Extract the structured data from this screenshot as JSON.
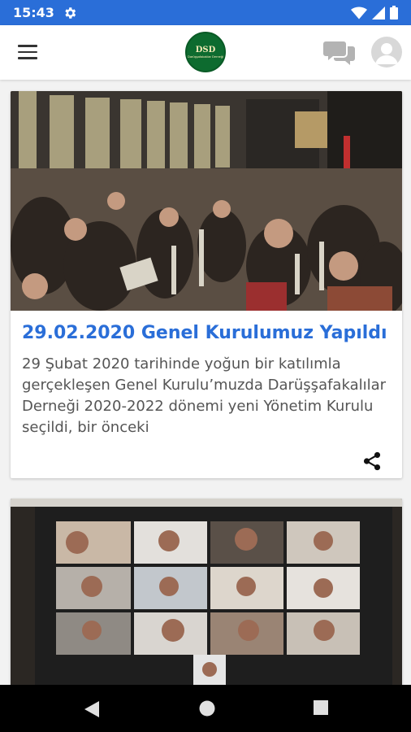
{
  "status_bar": {
    "time": "15:43",
    "icons": [
      "settings-gear-icon",
      "wifi-icon",
      "cellular-signal-icon",
      "battery-icon"
    ],
    "background": "#2a6ed8"
  },
  "app_bar": {
    "logo_monogram": "DSD",
    "logo_text": "Darüşşafakalılar Derneği",
    "icons": [
      "menu-icon",
      "chat-icon",
      "account-icon"
    ]
  },
  "feed": {
    "posts": [
      {
        "title": "29.02.2020 Genel Kurulumuz Yapıldı",
        "excerpt": "29 Şubat 2020 tarihinde yoğun bir katılımla gerçekleşen Genel Kurulu’muzda Darüşşafakalılar Derneği 2020-2022 dönemi yeni Yönetim Kurulu seçildi, bir önceki",
        "image": "conference-hall-audience-photo",
        "title_color": "#2a6ed8"
      },
      {
        "image": "video-conference-meeting-screenshot"
      }
    ]
  },
  "nav_bar": {
    "icons": [
      "back-icon",
      "home-icon",
      "recent-apps-icon"
    ]
  }
}
